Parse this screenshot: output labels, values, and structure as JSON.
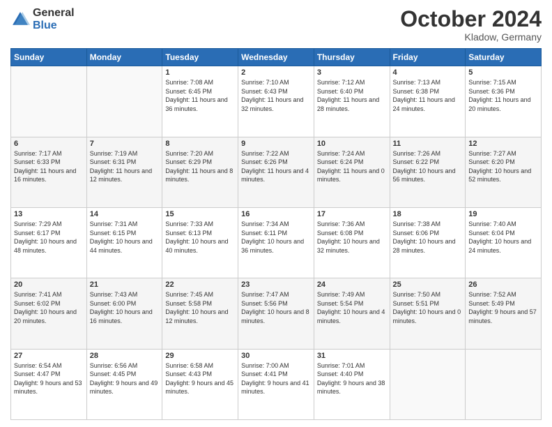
{
  "logo": {
    "general": "General",
    "blue": "Blue"
  },
  "header": {
    "month": "October 2024",
    "location": "Kladow, Germany"
  },
  "weekdays": [
    "Sunday",
    "Monday",
    "Tuesday",
    "Wednesday",
    "Thursday",
    "Friday",
    "Saturday"
  ],
  "weeks": [
    [
      {
        "day": "",
        "content": ""
      },
      {
        "day": "",
        "content": ""
      },
      {
        "day": "1",
        "content": "Sunrise: 7:08 AM\nSunset: 6:45 PM\nDaylight: 11 hours\nand 36 minutes."
      },
      {
        "day": "2",
        "content": "Sunrise: 7:10 AM\nSunset: 6:43 PM\nDaylight: 11 hours\nand 32 minutes."
      },
      {
        "day": "3",
        "content": "Sunrise: 7:12 AM\nSunset: 6:40 PM\nDaylight: 11 hours\nand 28 minutes."
      },
      {
        "day": "4",
        "content": "Sunrise: 7:13 AM\nSunset: 6:38 PM\nDaylight: 11 hours\nand 24 minutes."
      },
      {
        "day": "5",
        "content": "Sunrise: 7:15 AM\nSunset: 6:36 PM\nDaylight: 11 hours\nand 20 minutes."
      }
    ],
    [
      {
        "day": "6",
        "content": "Sunrise: 7:17 AM\nSunset: 6:33 PM\nDaylight: 11 hours\nand 16 minutes."
      },
      {
        "day": "7",
        "content": "Sunrise: 7:19 AM\nSunset: 6:31 PM\nDaylight: 11 hours\nand 12 minutes."
      },
      {
        "day": "8",
        "content": "Sunrise: 7:20 AM\nSunset: 6:29 PM\nDaylight: 11 hours\nand 8 minutes."
      },
      {
        "day": "9",
        "content": "Sunrise: 7:22 AM\nSunset: 6:26 PM\nDaylight: 11 hours\nand 4 minutes."
      },
      {
        "day": "10",
        "content": "Sunrise: 7:24 AM\nSunset: 6:24 PM\nDaylight: 11 hours\nand 0 minutes."
      },
      {
        "day": "11",
        "content": "Sunrise: 7:26 AM\nSunset: 6:22 PM\nDaylight: 10 hours\nand 56 minutes."
      },
      {
        "day": "12",
        "content": "Sunrise: 7:27 AM\nSunset: 6:20 PM\nDaylight: 10 hours\nand 52 minutes."
      }
    ],
    [
      {
        "day": "13",
        "content": "Sunrise: 7:29 AM\nSunset: 6:17 PM\nDaylight: 10 hours\nand 48 minutes."
      },
      {
        "day": "14",
        "content": "Sunrise: 7:31 AM\nSunset: 6:15 PM\nDaylight: 10 hours\nand 44 minutes."
      },
      {
        "day": "15",
        "content": "Sunrise: 7:33 AM\nSunset: 6:13 PM\nDaylight: 10 hours\nand 40 minutes."
      },
      {
        "day": "16",
        "content": "Sunrise: 7:34 AM\nSunset: 6:11 PM\nDaylight: 10 hours\nand 36 minutes."
      },
      {
        "day": "17",
        "content": "Sunrise: 7:36 AM\nSunset: 6:08 PM\nDaylight: 10 hours\nand 32 minutes."
      },
      {
        "day": "18",
        "content": "Sunrise: 7:38 AM\nSunset: 6:06 PM\nDaylight: 10 hours\nand 28 minutes."
      },
      {
        "day": "19",
        "content": "Sunrise: 7:40 AM\nSunset: 6:04 PM\nDaylight: 10 hours\nand 24 minutes."
      }
    ],
    [
      {
        "day": "20",
        "content": "Sunrise: 7:41 AM\nSunset: 6:02 PM\nDaylight: 10 hours\nand 20 minutes."
      },
      {
        "day": "21",
        "content": "Sunrise: 7:43 AM\nSunset: 6:00 PM\nDaylight: 10 hours\nand 16 minutes."
      },
      {
        "day": "22",
        "content": "Sunrise: 7:45 AM\nSunset: 5:58 PM\nDaylight: 10 hours\nand 12 minutes."
      },
      {
        "day": "23",
        "content": "Sunrise: 7:47 AM\nSunset: 5:56 PM\nDaylight: 10 hours\nand 8 minutes."
      },
      {
        "day": "24",
        "content": "Sunrise: 7:49 AM\nSunset: 5:54 PM\nDaylight: 10 hours\nand 4 minutes."
      },
      {
        "day": "25",
        "content": "Sunrise: 7:50 AM\nSunset: 5:51 PM\nDaylight: 10 hours\nand 0 minutes."
      },
      {
        "day": "26",
        "content": "Sunrise: 7:52 AM\nSunset: 5:49 PM\nDaylight: 9 hours\nand 57 minutes."
      }
    ],
    [
      {
        "day": "27",
        "content": "Sunrise: 6:54 AM\nSunset: 4:47 PM\nDaylight: 9 hours\nand 53 minutes."
      },
      {
        "day": "28",
        "content": "Sunrise: 6:56 AM\nSunset: 4:45 PM\nDaylight: 9 hours\nand 49 minutes."
      },
      {
        "day": "29",
        "content": "Sunrise: 6:58 AM\nSunset: 4:43 PM\nDaylight: 9 hours\nand 45 minutes."
      },
      {
        "day": "30",
        "content": "Sunrise: 7:00 AM\nSunset: 4:41 PM\nDaylight: 9 hours\nand 41 minutes."
      },
      {
        "day": "31",
        "content": "Sunrise: 7:01 AM\nSunset: 4:40 PM\nDaylight: 9 hours\nand 38 minutes."
      },
      {
        "day": "",
        "content": ""
      },
      {
        "day": "",
        "content": ""
      }
    ]
  ]
}
